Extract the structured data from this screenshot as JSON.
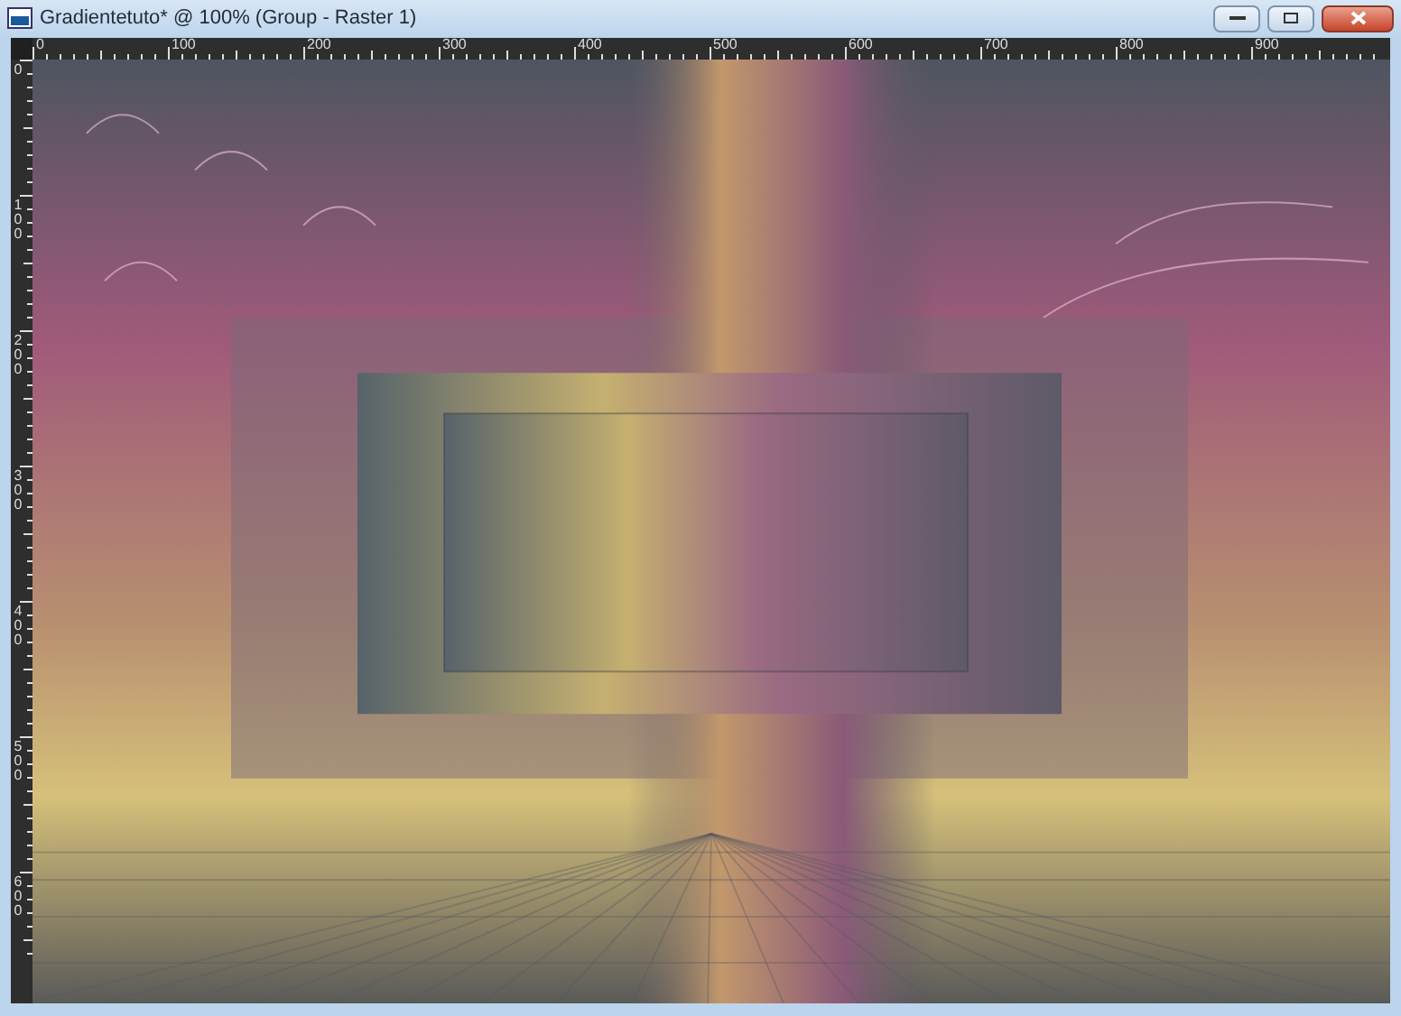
{
  "window": {
    "title": "Gradientetuto* @ 100% (Group - Raster 1)"
  },
  "rulers": {
    "horizontal": [
      "0",
      "100",
      "200",
      "300",
      "400",
      "500",
      "600",
      "700",
      "800",
      "900"
    ],
    "vertical": [
      "0",
      "100",
      "200",
      "300",
      "400",
      "500",
      "600"
    ]
  }
}
